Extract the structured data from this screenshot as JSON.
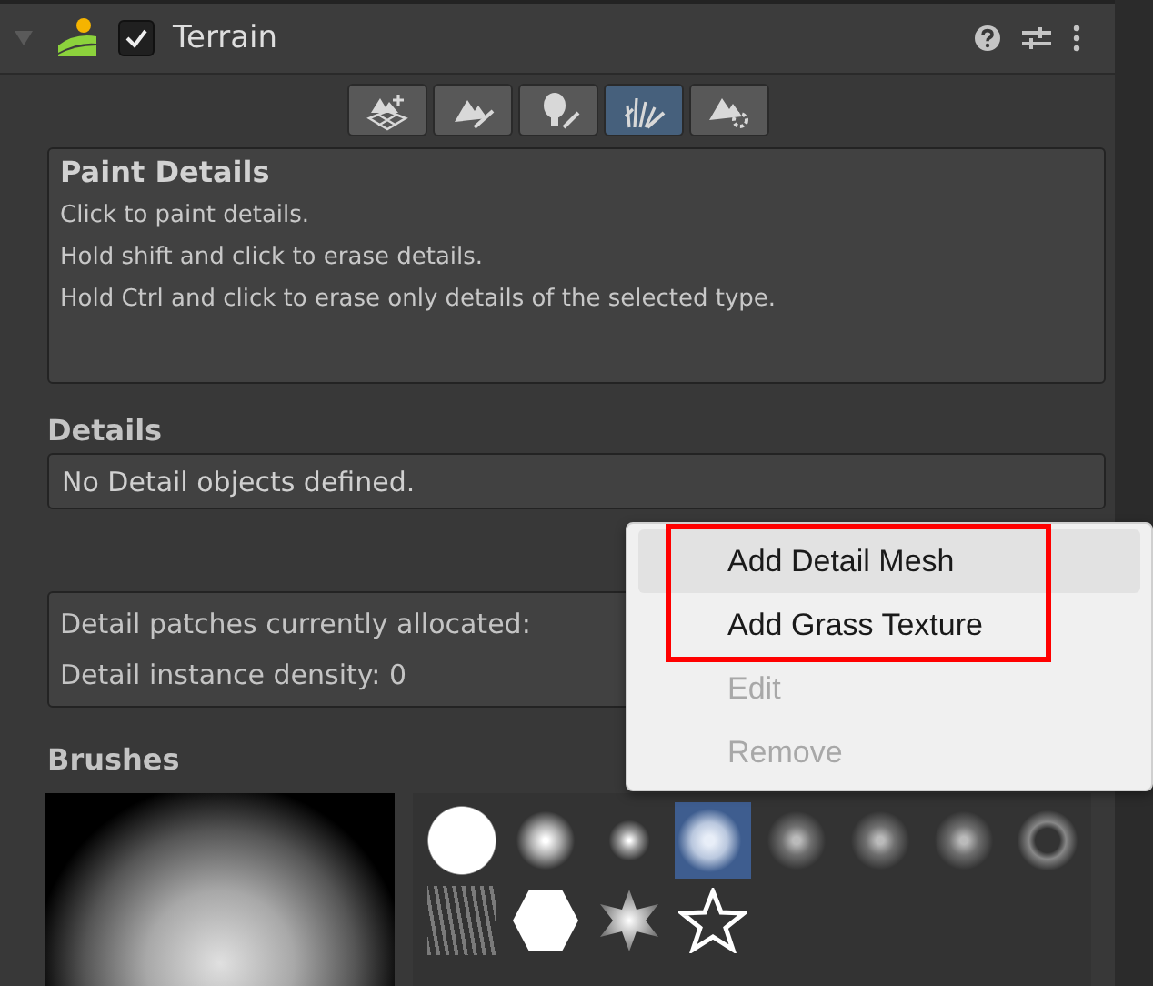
{
  "header": {
    "title": "Terrain",
    "enabled": true,
    "expanded": true
  },
  "tools": [
    {
      "kind": "create",
      "selected": false
    },
    {
      "kind": "sculpt",
      "selected": false
    },
    {
      "kind": "trees",
      "selected": false
    },
    {
      "kind": "details",
      "selected": true
    },
    {
      "kind": "settings",
      "selected": false
    }
  ],
  "paint_details": {
    "title": "Paint Details",
    "lines": [
      "Click to paint details.",
      "Hold shift and click to erase details.",
      "Hold Ctrl and click to erase only details of the selected type."
    ]
  },
  "details": {
    "label": "Details",
    "list_text": "No Detail objects defined."
  },
  "info": [
    "Detail patches currently allocated:",
    "Detail instance density: 0"
  ],
  "brushes": {
    "label": "Brushes",
    "items": [
      {
        "kind": "hard",
        "selected": false
      },
      {
        "kind": "soft",
        "selected": false
      },
      {
        "kind": "soft-small",
        "selected": false
      },
      {
        "kind": "cloud",
        "selected": true
      },
      {
        "kind": "noise",
        "selected": false
      },
      {
        "kind": "noise",
        "selected": false
      },
      {
        "kind": "noise",
        "selected": false
      },
      {
        "kind": "cells",
        "selected": false
      },
      {
        "kind": "streaks",
        "selected": false
      },
      {
        "kind": "hexagon",
        "selected": false
      },
      {
        "kind": "star-glow",
        "selected": false
      },
      {
        "kind": "star-outline",
        "selected": false
      }
    ]
  },
  "context_menu": {
    "highlighted_items": [
      {
        "label": "Add Detail Mesh",
        "selected": true,
        "disabled": false
      },
      {
        "label": "Add Grass Texture",
        "selected": false,
        "disabled": false
      }
    ],
    "items": [
      {
        "label": "Edit",
        "selected": false,
        "disabled": true
      },
      {
        "label": "Remove",
        "selected": false,
        "disabled": true
      }
    ]
  }
}
